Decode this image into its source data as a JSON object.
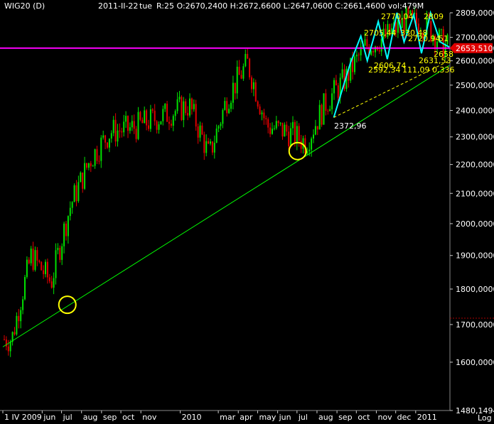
{
  "header": {
    "symbol": "WIG20 (D)",
    "date": "2011-II-22",
    "day": "tue",
    "ohlc": "R:25 O:2670,2400 H:2672,6600 L:2647,0600 C:2661,4600 vol:479M"
  },
  "footer": {
    "log_label": "Log"
  },
  "colors": {
    "background": "#000000",
    "up_candle": "#00e000",
    "down_candle": "#e00000",
    "trendline": "#00ff00",
    "horizontal_line": "#ff00ff",
    "zigzag": "#00ffff",
    "annotation": "#ffff00",
    "price_tag": "#e00000"
  },
  "chart_data": {
    "type": "candlestick",
    "title": "WIG20 (D)",
    "scale": "log",
    "ylim": [
      1480.1494,
      2809
    ],
    "y_ticks": [
      "2809,0000",
      "2700,0000",
      "2600,0000",
      "2500,0000",
      "2400,0000",
      "2300,0000",
      "2200,0000",
      "2100,0000",
      "2000,0000",
      "1900,0000",
      "1800,0000",
      "1700,0000",
      "1600,0000",
      "1480,1494"
    ],
    "x_ticks": [
      "1 IV 2009",
      "jun",
      "jul",
      "aug",
      "sep",
      "oct",
      "nov",
      "2010",
      "mar",
      "apr",
      "may",
      "jun",
      "jul",
      "aug",
      "sep",
      "oct",
      "nov",
      "dec",
      "2011"
    ],
    "last_price_tag": "2653,5100",
    "horizontal_line": 2653.51,
    "trendline": {
      "from": [
        "2009-04-01",
        1640
      ],
      "to": [
        "2011-02-22",
        2580
      ]
    },
    "circled_lows": [
      [
        "2009-07-10",
        1755
      ],
      [
        "2010-07-02",
        2248
      ]
    ],
    "series_close_monthly": [
      {
        "x": "2009-04",
        "close": 1660
      },
      {
        "x": "2009-05",
        "close": 1900
      },
      {
        "x": "2009-06",
        "close": 1820
      },
      {
        "x": "2009-07",
        "close": 2060
      },
      {
        "x": "2009-08",
        "close": 2220
      },
      {
        "x": "2009-09",
        "close": 2320
      },
      {
        "x": "2009-10",
        "close": 2330
      },
      {
        "x": "2009-11",
        "close": 2360
      },
      {
        "x": "2010-01",
        "close": 2420
      },
      {
        "x": "2010-02",
        "close": 2230
      },
      {
        "x": "2010-03",
        "close": 2450
      },
      {
        "x": "2010-04",
        "close": 2590
      },
      {
        "x": "2010-05",
        "close": 2340
      },
      {
        "x": "2010-06",
        "close": 2320
      },
      {
        "x": "2010-07",
        "close": 2280
      },
      {
        "x": "2010-08",
        "close": 2430
      },
      {
        "x": "2010-09",
        "close": 2530
      },
      {
        "x": "2010-10",
        "close": 2660
      },
      {
        "x": "2010-11",
        "close": 2700
      },
      {
        "x": "2010-12",
        "close": 2770
      },
      {
        "x": "2011-01",
        "close": 2760
      },
      {
        "x": "2011-02",
        "close": 2661.46
      }
    ],
    "annotations": [
      "2372,96",
      "2705,44",
      "330,48",
      "2592,34",
      "111,09",
      "0,336",
      "2770,04",
      "2606,74",
      "2631,53",
      "2720,94",
      "51",
      "2809",
      "2658"
    ]
  }
}
